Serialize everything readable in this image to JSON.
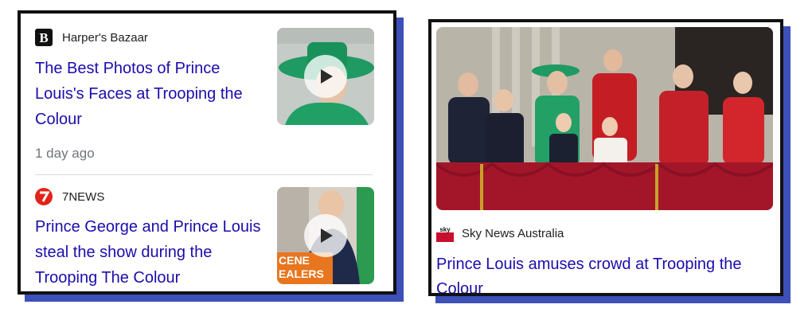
{
  "articles": [
    {
      "source": "Harper's Bazaar",
      "title": "The Best Photos of Prince Louis's Faces at Trooping the Colour",
      "age": "1 day ago",
      "logo_icon": "harpers-bazaar-b-logo",
      "thumb_icon": "green-hat-woman-video-thumbnail"
    },
    {
      "source": "7NEWS",
      "title": "Prince George and Prince Louis steal the show during the Trooping The Colour",
      "logo_icon": "7news-logo",
      "thumb_icon": "prince-george-video-thumbnail",
      "thumb_overlay": "CENE\nEALERS"
    }
  ],
  "featured": {
    "source": "Sky News Australia",
    "logo_text": "sky news",
    "title": "Prince Louis amuses crowd at Trooping the Colour",
    "image_icon": "royal-family-balcony-photo"
  },
  "colors": {
    "link": "#1a0dab",
    "meta": "#70757a",
    "shadow": "#3d4fb8",
    "seven_red": "#e2231a",
    "sky_red": "#c8102e"
  }
}
